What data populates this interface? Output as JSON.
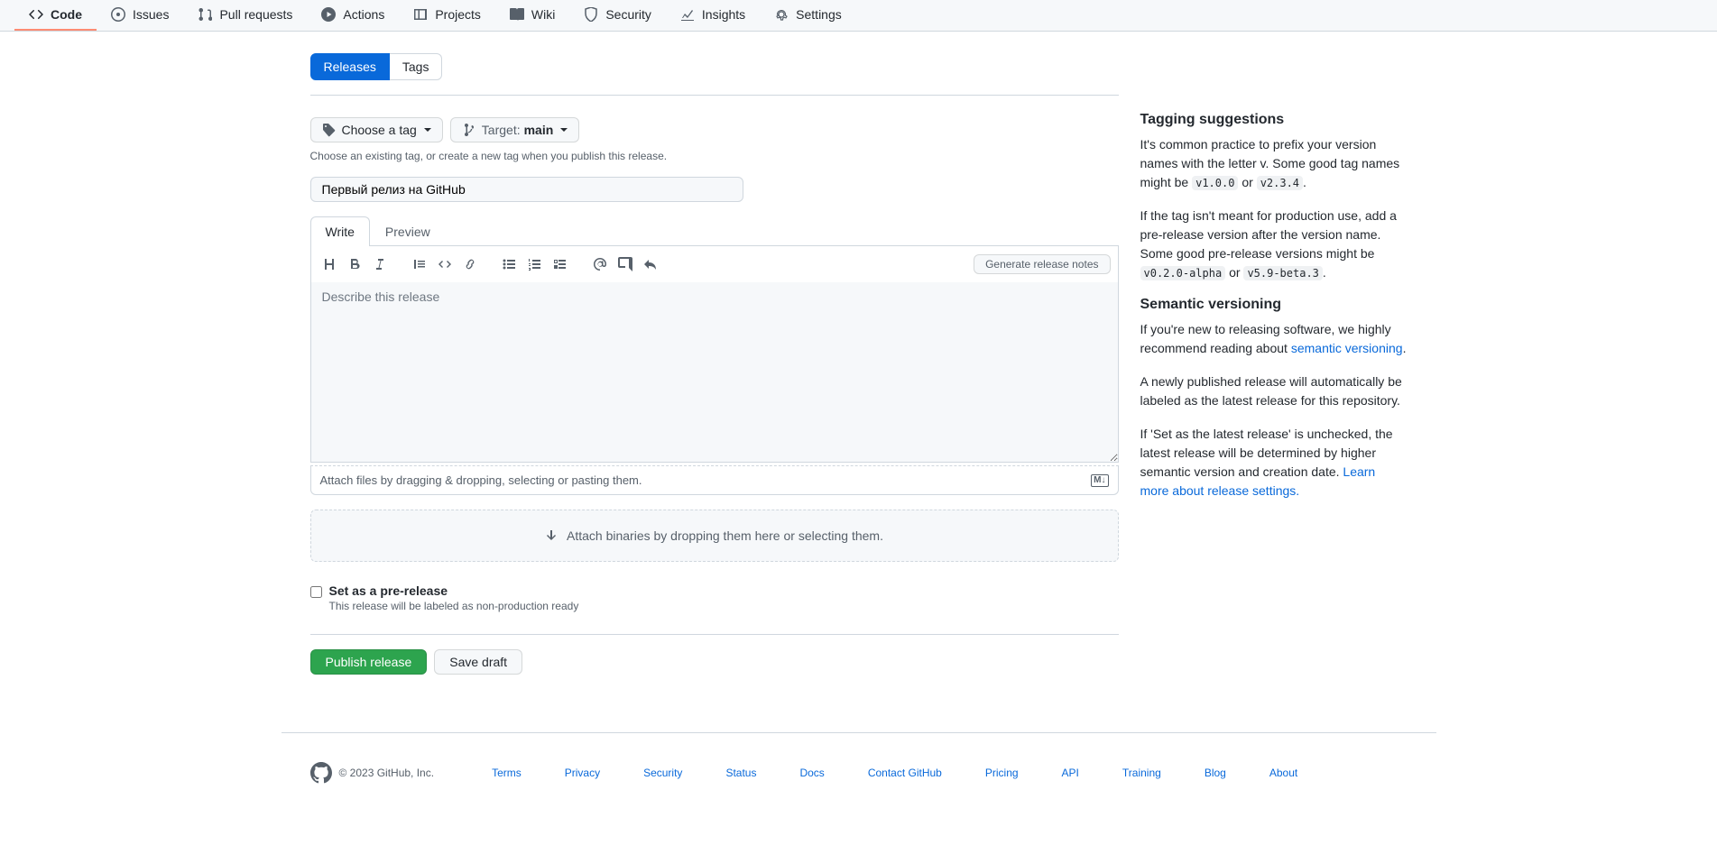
{
  "nav": {
    "items": [
      {
        "label": "Code"
      },
      {
        "label": "Issues"
      },
      {
        "label": "Pull requests"
      },
      {
        "label": "Actions"
      },
      {
        "label": "Projects"
      },
      {
        "label": "Wiki"
      },
      {
        "label": "Security"
      },
      {
        "label": "Insights"
      },
      {
        "label": "Settings"
      }
    ]
  },
  "subnav": {
    "releases": "Releases",
    "tags": "Tags"
  },
  "form": {
    "choose_tag": "Choose a tag",
    "target_label": "Target:",
    "target_branch": "main",
    "tag_hint": "Choose an existing tag, or create a new tag when you publish this release.",
    "title_value": "Первый релиз на GitHub",
    "tab_write": "Write",
    "tab_preview": "Preview",
    "gen_notes": "Generate release notes",
    "desc_placeholder": "Describe this release",
    "attach_hint": "Attach files by dragging & dropping, selecting or pasting them.",
    "binaries_hint": "Attach binaries by dropping them here or selecting them.",
    "prerelease_label": "Set as a pre-release",
    "prerelease_desc": "This release will be labeled as non-production ready",
    "publish": "Publish release",
    "save_draft": "Save draft"
  },
  "sidebar": {
    "tagging_title": "Tagging suggestions",
    "tagging_p1_a": "It's common practice to prefix your version names with the letter v. Some good tag names might be ",
    "tagging_code1": "v1.0.0",
    "tagging_or": " or ",
    "tagging_code2": "v2.3.4",
    "tagging_p2_a": "If the tag isn't meant for production use, add a pre-release version after the version name. Some good pre-release versions might be ",
    "tagging_code3": "v0.2.0-alpha",
    "tagging_code4": "v5.9-beta.3",
    "semver_title": "Semantic versioning",
    "semver_p1_a": "If you're new to releasing software, we highly recommend reading about ",
    "semver_link": "semantic versioning",
    "semver_p2": "A newly published release will automatically be labeled as the latest release for this repository.",
    "semver_p3_a": "If 'Set as the latest release' is unchecked, the latest release will be determined by higher semantic version and creation date. ",
    "semver_link2": "Learn more about release settings."
  },
  "footer": {
    "copyright": "© 2023 GitHub, Inc.",
    "links": [
      "Terms",
      "Privacy",
      "Security",
      "Status",
      "Docs",
      "Contact GitHub",
      "Pricing",
      "API",
      "Training",
      "Blog",
      "About"
    ]
  }
}
